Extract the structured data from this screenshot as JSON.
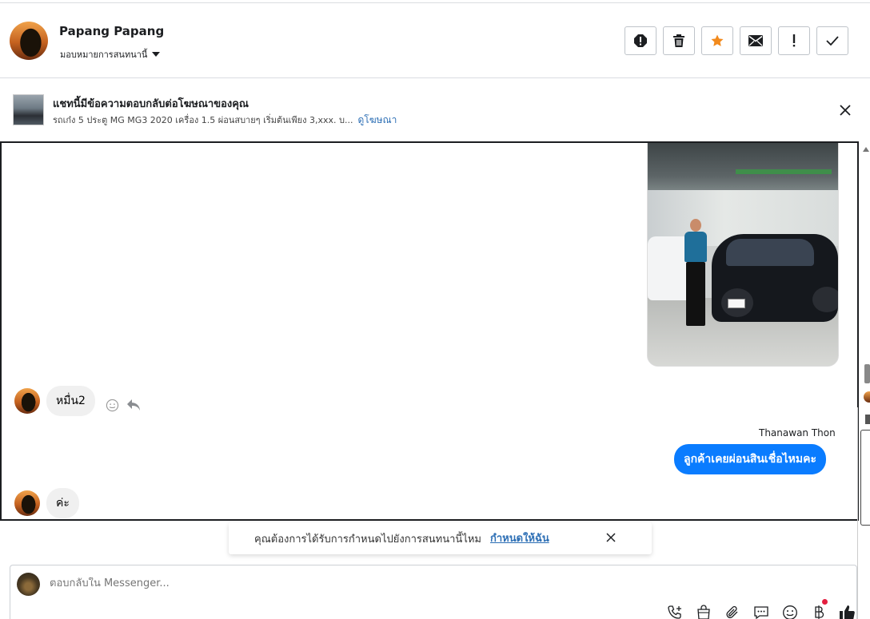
{
  "header": {
    "name": "Papang Papang",
    "assign_label": "มอบหมายการสนทนานี้",
    "actions": [
      "report-icon",
      "trash-icon",
      "star-icon",
      "envelope-icon",
      "exclamation-icon",
      "check-icon"
    ],
    "star_color": "#f28a1d"
  },
  "ad": {
    "title": "แชทนี้มีข้อความตอบกลับต่อโฆษณาของคุณ",
    "description": "รถเก๋ง 5 ประตู MG MG3 2020 เครื่อง 1.5 ผ่อนสบายๆ เริ่มต้นเพียง 3,xxx. บ...",
    "link": "ดูโฆษณา"
  },
  "messages": {
    "incoming_1": "หมื่น2",
    "sender_out": "Thanawan Thon",
    "outgoing_1": "ลูกค้าเคยผ่อนสินเชื่อไหมคะ",
    "incoming_2": "ค่ะ"
  },
  "toast": {
    "text": "คุณต้องการได้รับการกำหนดไปยังการสนทนานี้ไหม",
    "link": "กำหนดให้ฉัน"
  },
  "composer": {
    "placeholder": "ตอบกลับใน Messenger..."
  },
  "colors": {
    "accent": "#0a7cff",
    "link": "#2d6fb5"
  }
}
